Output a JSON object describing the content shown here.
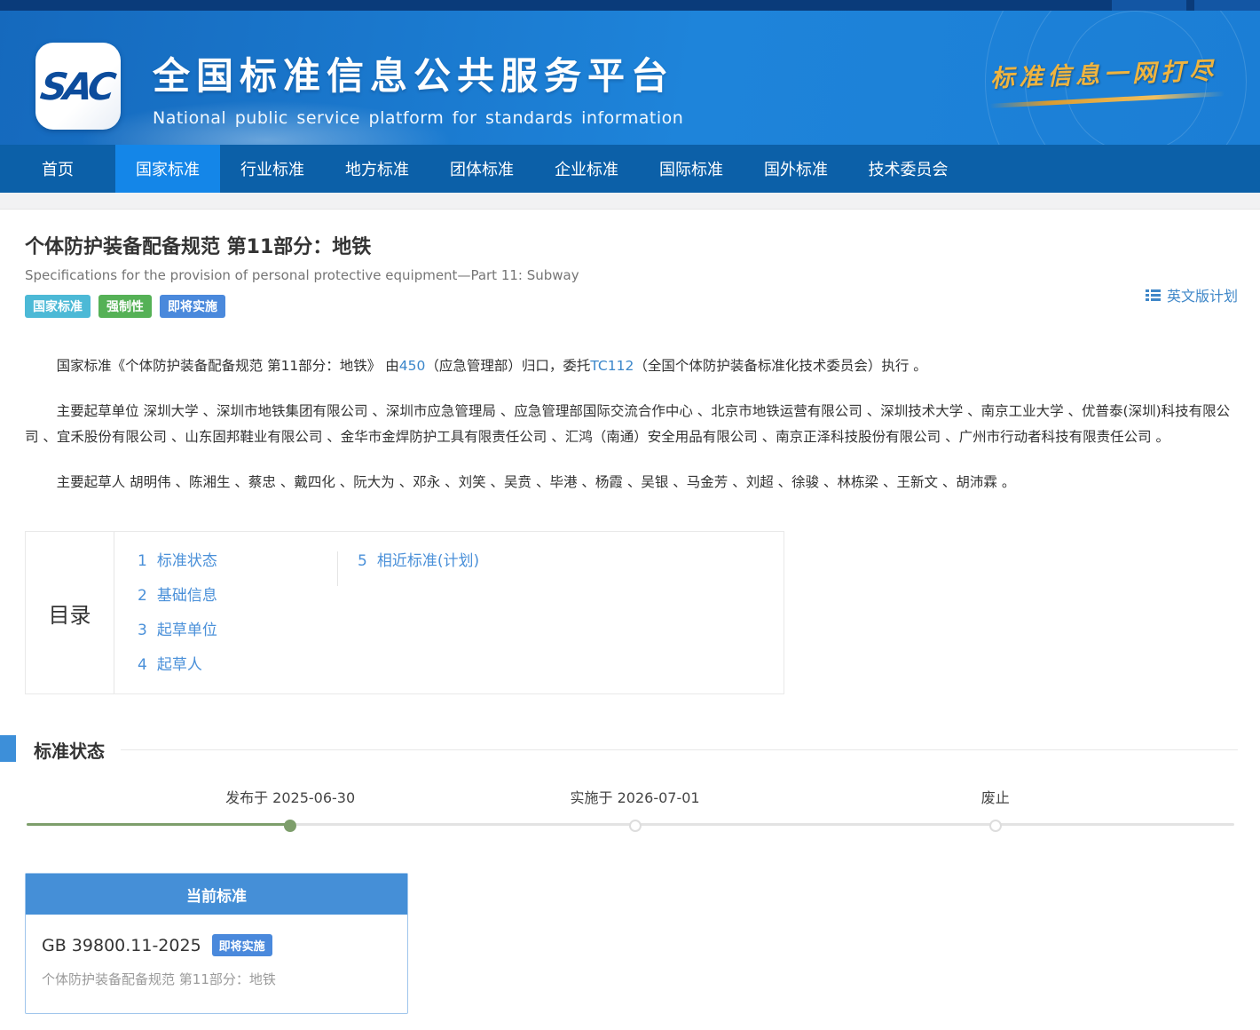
{
  "header": {
    "logo_text": "SAC",
    "title": "全国标准信息公共服务平台",
    "subtitle": "National public service platform for standards information",
    "slogan": "标准信息一网打尽"
  },
  "nav": {
    "items": [
      {
        "label": "首页",
        "active": false
      },
      {
        "label": "国家标准",
        "active": true
      },
      {
        "label": "行业标准",
        "active": false
      },
      {
        "label": "地方标准",
        "active": false
      },
      {
        "label": "团体标准",
        "active": false
      },
      {
        "label": "企业标准",
        "active": false
      },
      {
        "label": "国际标准",
        "active": false
      },
      {
        "label": "国外标准",
        "active": false
      },
      {
        "label": "技术委员会",
        "active": false
      }
    ]
  },
  "page": {
    "title": "个体防护装备配备规范 第11部分：地铁",
    "subtitle_en": "Specifications for the provision of personal protective equipment—Part 11: Subway",
    "tags": [
      {
        "label": "国家标准",
        "color": "#4cb9d6"
      },
      {
        "label": "强制性",
        "color": "#55b156"
      },
      {
        "label": "即将实施",
        "color": "#4a89dc"
      }
    ],
    "english_plan_link": "英文版计划"
  },
  "intro": {
    "p1_prefix": "国家标准《个体防护装备配备规范 第11部分：地铁》 由",
    "p1_link1": "450",
    "p1_mid": "（应急管理部）归口，委托",
    "p1_link2": "TC112",
    "p1_suffix": "（全国个体防护装备标准化技术委员会）执行 。",
    "p2": "主要起草单位 深圳大学 、深圳市地铁集团有限公司 、深圳市应急管理局 、应急管理部国际交流合作中心 、北京市地铁运营有限公司 、深圳技术大学 、南京工业大学 、优普泰(深圳)科技有限公司 、宜禾股份有限公司 、山东固邦鞋业有限公司 、金华市金焊防护工具有限责任公司 、汇鸿（南通）安全用品有限公司 、南京正泽科技股份有限公司 、广州市行动者科技有限责任公司 。",
    "p3": "主要起草人 胡明伟 、陈湘生 、蔡忠 、戴四化 、阮大为 、邓永 、刘笑 、吴贲 、毕港 、杨霞 、吴银 、马金芳 、刘超 、徐骏 、林栋梁 、王新文 、胡沛霖 。"
  },
  "toc": {
    "label": "目录",
    "col1": [
      {
        "num": "1",
        "label": "标准状态"
      },
      {
        "num": "2",
        "label": "基础信息"
      },
      {
        "num": "3",
        "label": "起草单位"
      },
      {
        "num": "4",
        "label": "起草人"
      }
    ],
    "col2": [
      {
        "num": "5",
        "label": "相近标准(计划)"
      }
    ]
  },
  "status_section": {
    "title": "标准状态",
    "timeline": [
      {
        "label": "发布于 2025-06-30",
        "state": "done",
        "pos": 21.8
      },
      {
        "label": "实施于 2026-07-01",
        "state": "pending",
        "pos": 50.3
      },
      {
        "label": "废止",
        "state": "pending",
        "pos": 80.1
      }
    ]
  },
  "current_standard": {
    "header": "当前标准",
    "code": "GB 39800.11-2025",
    "badge": "即将实施",
    "description": "个体防护装备配备规范 第11部分：地铁"
  }
}
